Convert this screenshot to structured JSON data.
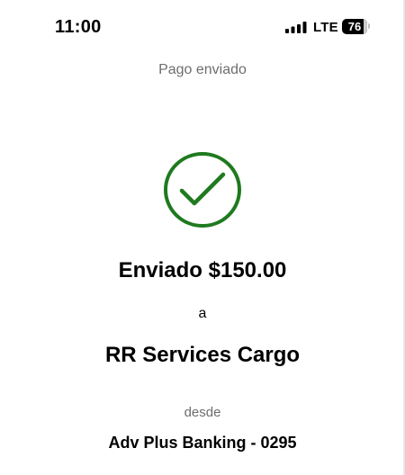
{
  "status_bar": {
    "time": "11:00",
    "network": "LTE",
    "battery": "76",
    "icons": [
      "signal-bars-icon",
      "battery-icon"
    ]
  },
  "screen": {
    "title": "Pago enviado",
    "status_icon": "checkmark-circle-icon",
    "headline": "Enviado $150.00",
    "connector": "a",
    "recipient": "RR Services Cargo",
    "from_label": "desde",
    "account": "Adv Plus Banking - 0295"
  },
  "colors": {
    "success": "#1f7a1f",
    "secondary_text": "#6e6e6e",
    "primary_text": "#000000",
    "background": "#ffffff"
  }
}
